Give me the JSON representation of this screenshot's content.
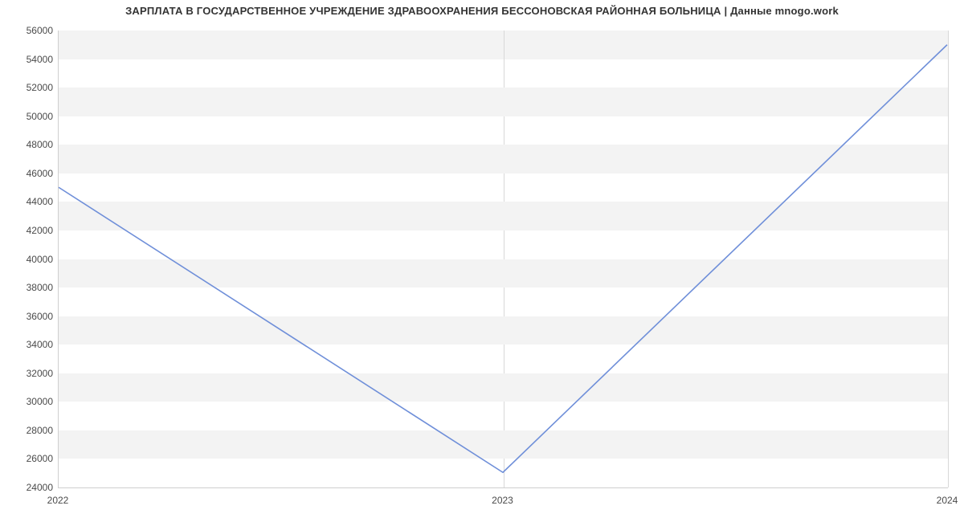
{
  "chart_data": {
    "type": "line",
    "title": "ЗАРПЛАТА В ГОСУДАРСТВЕННОЕ УЧРЕЖДЕНИЕ ЗДРАВООХРАНЕНИЯ БЕССОНОВСКАЯ РАЙОННАЯ БОЛЬНИЦА | Данные mnogo.work",
    "xlabel": "",
    "ylabel": "",
    "x": [
      2022,
      2023,
      2024
    ],
    "values": [
      45000,
      25000,
      55000
    ],
    "x_ticks": [
      2022,
      2023,
      2024
    ],
    "y_ticks": [
      24000,
      26000,
      28000,
      30000,
      32000,
      34000,
      36000,
      38000,
      40000,
      42000,
      44000,
      46000,
      48000,
      50000,
      52000,
      54000,
      56000
    ],
    "xlim": [
      2022,
      2024
    ],
    "ylim": [
      24000,
      56000
    ],
    "grid": true,
    "line_color": "#6f8fd9"
  }
}
